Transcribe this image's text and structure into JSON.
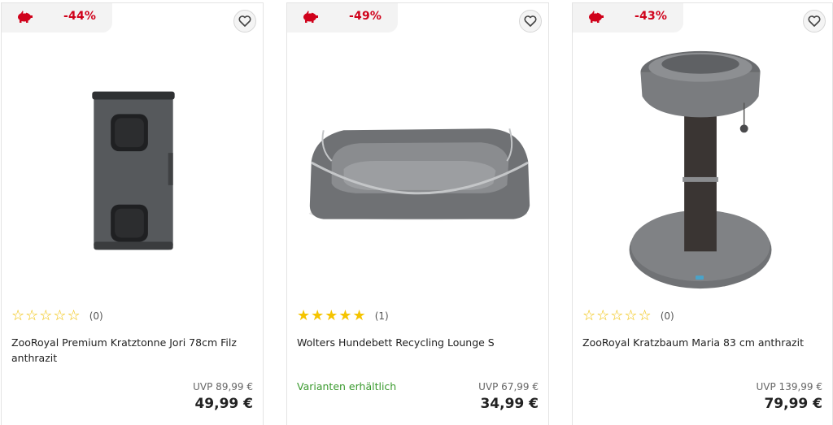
{
  "products": [
    {
      "discount": "-44%",
      "rating_count": "(0)",
      "stars_filled": 0,
      "title": "ZooRoyal Premium Kratztonne Jori 78cm Filz anthrazit",
      "variants": "",
      "uvp": "UVP 89,99 €",
      "price": "49,99 €",
      "image": "cat-scratch-barrel-image"
    },
    {
      "discount": "-49%",
      "rating_count": "(1)",
      "stars_filled": 5,
      "title": "Wolters Hundebett Recycling Lounge S",
      "variants": "Varianten erhältlich",
      "uvp": "UVP 67,99 €",
      "price": "34,99 €",
      "image": "dog-bed-image"
    },
    {
      "discount": "-43%",
      "rating_count": "(0)",
      "stars_filled": 0,
      "title": "ZooRoyal Kratzbaum Maria 83 cm anthrazit",
      "variants": "",
      "uvp": "UVP 139,99 €",
      "price": "79,99 €",
      "image": "cat-tree-image"
    }
  ],
  "colors": {
    "discount": "#d0021b",
    "star": "#f5c400",
    "variants": "#3a9a2e"
  }
}
